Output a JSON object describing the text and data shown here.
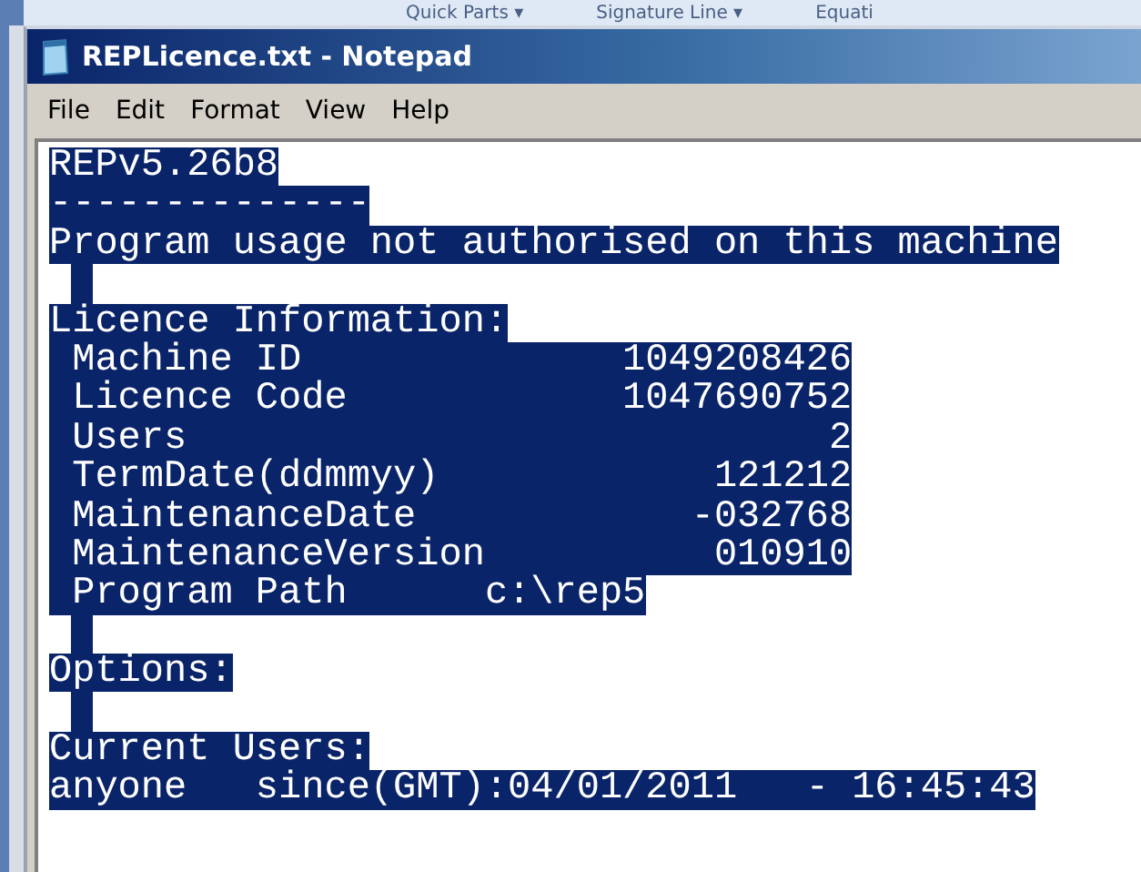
{
  "background_ribbon": {
    "items": [
      "Quick Parts ▾",
      "Signature Line ▾",
      "Equati"
    ]
  },
  "window": {
    "title": "REPLicence.txt - Notepad"
  },
  "menu": [
    "File",
    "Edit",
    "Format",
    "View",
    "Help"
  ],
  "editor": {
    "all_selected": true,
    "lines": [
      {
        "kind": "text",
        "text": "REPv5.26b8"
      },
      {
        "kind": "text",
        "text": "--------------"
      },
      {
        "kind": "text",
        "text": "Program usage not authorised on this machine"
      },
      {
        "kind": "blank"
      },
      {
        "kind": "text",
        "text": "Licence Information:"
      },
      {
        "kind": "text",
        "text": " Machine ID              1049208426"
      },
      {
        "kind": "text",
        "text": " Licence Code            1047690752"
      },
      {
        "kind": "text",
        "text": " Users                            2"
      },
      {
        "kind": "text",
        "text": " TermDate(ddmmyy)            121212"
      },
      {
        "kind": "text",
        "text": " MaintenanceDate            -032768"
      },
      {
        "kind": "text",
        "text": " MaintenanceVersion          010910"
      },
      {
        "kind": "text",
        "text": " Program Path      c:\\rep5"
      },
      {
        "kind": "blank"
      },
      {
        "kind": "text",
        "text": "Options:"
      },
      {
        "kind": "blank"
      },
      {
        "kind": "text",
        "text": "Current Users:"
      },
      {
        "kind": "text",
        "text": "anyone   since(GMT):04/01/2011   - 16:45:43"
      }
    ]
  }
}
